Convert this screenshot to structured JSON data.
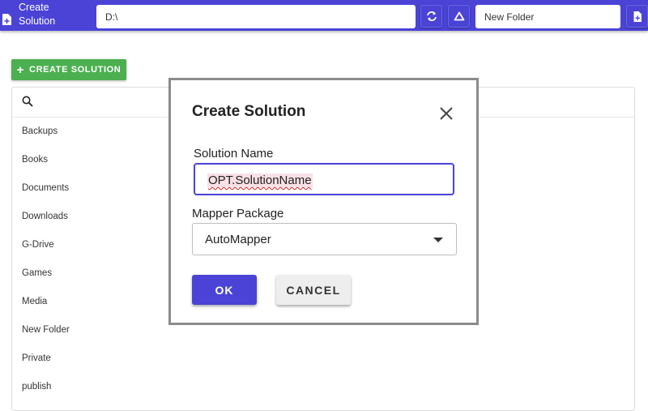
{
  "colors": {
    "accent": "#4a43d6",
    "success": "#4caf50",
    "dialog_border": "#8b8b8b",
    "spellcheck": "#d02020"
  },
  "topbar": {
    "title": "Create Solution",
    "title_icon": "file-plus-icon",
    "path_value": "D:\\",
    "refresh_icon": "refresh-icon",
    "up_icon": "triangle-up-icon",
    "folder_value": "New Folder",
    "new_file_icon": "file-plus-icon"
  },
  "main": {
    "create_button_label": "CREATE SOLUTION",
    "create_button_icon": "plus",
    "search_icon": "search-icon",
    "items": [
      "Backups",
      "Books",
      "Documents",
      "Downloads",
      "G-Drive",
      "Games",
      "Media",
      "New Folder",
      "Private",
      "publish"
    ]
  },
  "dialog": {
    "title": "Create Solution",
    "close_icon": "close-icon",
    "name_label": "Solution Name",
    "name_value": "OPT.SolutionName",
    "mapper_label": "Mapper Package",
    "mapper_value": "AutoMapper",
    "ok_label": "OK",
    "cancel_label": "CANCEL"
  }
}
